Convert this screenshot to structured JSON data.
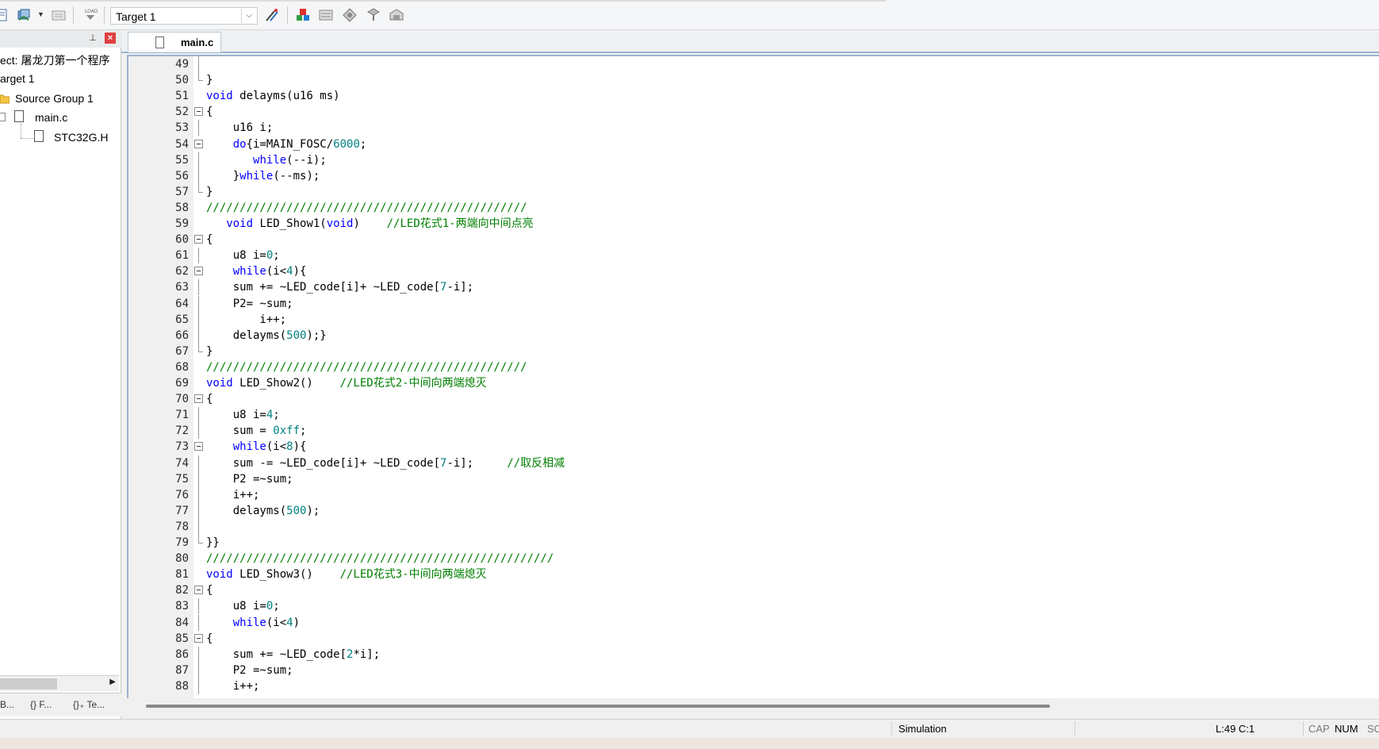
{
  "toolbar": {
    "target_value": "Target 1",
    "icons": [
      "build-icon",
      "rebuild-icon",
      "batch-build-icon",
      "load-icon",
      "target-options-icon",
      "manage-components-icon",
      "manage-books-icon",
      "select-packs-icon",
      "pack-installer-icon",
      "environment-icon"
    ]
  },
  "project_panel": {
    "project_label": "ect: 屠龙刀第一个程序",
    "target_label": "arget 1",
    "source_group": "Source Group 1",
    "main_file": "main.c",
    "header_file": "STC32G.H",
    "tabs": [
      "B...",
      "{} F...",
      "{}₊ Te..."
    ]
  },
  "editor": {
    "tab_label": "main.c",
    "lines": [
      {
        "n": "49",
        "f": "v",
        "h": ""
      },
      {
        "n": "50",
        "f": "e",
        "h": "}"
      },
      {
        "n": "51",
        "f": "",
        "h": "<span class=\"kw\">void</span> delayms(u16 ms)"
      },
      {
        "n": "52",
        "f": "b",
        "h": "{"
      },
      {
        "n": "53",
        "f": "v",
        "h": "    u16 i;"
      },
      {
        "n": "54",
        "f": "b",
        "h": "    <span class=\"kw\">do</span>{i=MAIN_FOSC/<span class=\"num\">6000</span>;"
      },
      {
        "n": "55",
        "f": "v",
        "h": "       <span class=\"kw\">while</span>(--i);"
      },
      {
        "n": "56",
        "f": "v",
        "h": "    }<span class=\"kw\">while</span>(--ms);"
      },
      {
        "n": "57",
        "f": "e",
        "h": "}"
      },
      {
        "n": "58",
        "f": "",
        "h": "<span class=\"cm\">////////////////////////////////////////////////</span>"
      },
      {
        "n": "59",
        "f": "",
        "h": "   <span class=\"kw\">void</span> LED_Show1(<span class=\"kw\">void</span>)    <span class=\"cm\">//LED花式1-两端向中间点亮</span>"
      },
      {
        "n": "60",
        "f": "b",
        "h": "{"
      },
      {
        "n": "61",
        "f": "v",
        "h": "    u8 i=<span class=\"num\">0</span>;"
      },
      {
        "n": "62",
        "f": "b",
        "h": "    <span class=\"kw\">while</span>(i&lt;<span class=\"num\">4</span>){"
      },
      {
        "n": "63",
        "f": "v",
        "h": "    sum += ~LED_code[i]+ ~LED_code[<span class=\"num\">7</span>-i];"
      },
      {
        "n": "64",
        "f": "v",
        "h": "    P2= ~sum;"
      },
      {
        "n": "65",
        "f": "v",
        "h": "        i++;"
      },
      {
        "n": "66",
        "f": "v",
        "h": "    delayms(<span class=\"num\">500</span>);}"
      },
      {
        "n": "67",
        "f": "e",
        "h": "}"
      },
      {
        "n": "68",
        "f": "",
        "h": "<span class=\"cm\">////////////////////////////////////////////////</span>"
      },
      {
        "n": "69",
        "f": "",
        "h": "<span class=\"kw\">void</span> LED_Show2()    <span class=\"cm\">//LED花式2-中间向两端熄灭</span>"
      },
      {
        "n": "70",
        "f": "b",
        "h": "{"
      },
      {
        "n": "71",
        "f": "v",
        "h": "    u8 i=<span class=\"num\">4</span>;"
      },
      {
        "n": "72",
        "f": "v",
        "h": "    sum = <span class=\"num\">0xff</span>;"
      },
      {
        "n": "73",
        "f": "b",
        "h": "    <span class=\"kw\">while</span>(i&lt;<span class=\"num\">8</span>){"
      },
      {
        "n": "74",
        "f": "v",
        "h": "    sum -= ~LED_code[i]+ ~LED_code[<span class=\"num\">7</span>-i];     <span class=\"cm\">//取反相减</span>"
      },
      {
        "n": "75",
        "f": "v",
        "h": "    P2 =~sum;"
      },
      {
        "n": "76",
        "f": "v",
        "h": "    i++;"
      },
      {
        "n": "77",
        "f": "v",
        "h": "    delayms(<span class=\"num\">500</span>);"
      },
      {
        "n": "78",
        "f": "v",
        "h": ""
      },
      {
        "n": "79",
        "f": "e",
        "h": "}}"
      },
      {
        "n": "80",
        "f": "",
        "h": "<span class=\"cm\">////////////////////////////////////////////////////</span>"
      },
      {
        "n": "81",
        "f": "",
        "h": "<span class=\"kw\">void</span> LED_Show3()    <span class=\"cm\">//LED花式3-中间向两端熄灭</span>"
      },
      {
        "n": "82",
        "f": "b",
        "h": "{"
      },
      {
        "n": "83",
        "f": "v",
        "h": "    u8 i=<span class=\"num\">0</span>;"
      },
      {
        "n": "84",
        "f": "v",
        "h": "    <span class=\"kw\">while</span>(i&lt;<span class=\"num\">4</span>)"
      },
      {
        "n": "85",
        "f": "b",
        "h": "{"
      },
      {
        "n": "86",
        "f": "v",
        "h": "    sum += ~LED_code[<span class=\"num\">2</span>*i];"
      },
      {
        "n": "87",
        "f": "v",
        "h": "    P2 =~sum;"
      },
      {
        "n": "88",
        "f": "v",
        "h": "    i++;"
      }
    ]
  },
  "status_bar": {
    "mode": "Simulation",
    "position": "L:49 C:1",
    "cap": "CAP",
    "num": "NUM",
    "scrl": "SC"
  }
}
